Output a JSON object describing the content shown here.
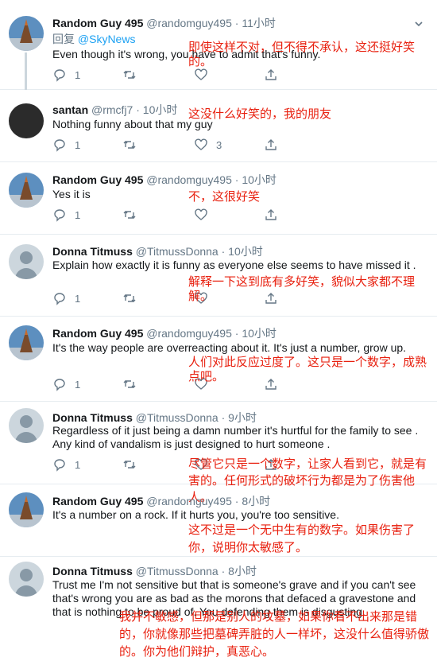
{
  "tweets": [
    {
      "name": "Random Guy 495",
      "handle": "@randomguy495",
      "time": "11小时",
      "reply_prefix": "回复",
      "reply_to": "@SkyNews",
      "text": "Even though it's wrong, you have to admit that's funny.",
      "replies": "1",
      "retweets": "",
      "likes": "",
      "translation": "即使这样不对，但不得不承认，这还挺好笑的。"
    },
    {
      "name": "santan",
      "handle": "@rmcfj7",
      "time": "10小时",
      "text": "Nothing funny about that my guy",
      "replies": "1",
      "retweets": "",
      "likes": "3",
      "translation": "这没什么好笑的，我的朋友"
    },
    {
      "name": "Random Guy 495",
      "handle": "@randomguy495",
      "time": "10小时",
      "text": "Yes it is",
      "replies": "1",
      "retweets": "",
      "likes": "",
      "translation": "不，这很好笑"
    },
    {
      "name": "Donna Titmuss",
      "handle": "@TitmussDonna",
      "time": "10小时",
      "text": "Explain how exactly it is funny as everyone else seems to have missed it .",
      "replies": "1",
      "retweets": "",
      "likes": "",
      "translation": "解释一下这到底有多好笑，貌似大家都不理解。"
    },
    {
      "name": "Random Guy 495",
      "handle": "@randomguy495",
      "time": "10小时",
      "text": "It's the way people are overreacting about it. It's just a number, grow up.",
      "replies": "1",
      "retweets": "",
      "likes": "",
      "translation": "人们对此反应过度了。这只是一个数字，成熟点吧。"
    },
    {
      "name": "Donna Titmuss",
      "handle": "@TitmussDonna",
      "time": "9小时",
      "text": "Regardless of it just being a damn number it's hurtful for the family to see . Any kind of vandalism is just designed to hurt someone .",
      "replies": "1",
      "retweets": "",
      "likes": "",
      "translation": "尽管它只是一个数字，让家人看到它，就是有害的。任何形式的破坏行为都是为了伤害他人。"
    },
    {
      "name": "Random Guy 495",
      "handle": "@randomguy495",
      "time": "8小时",
      "text": "It's a number on a rock. If it hurts you, you're too sensitive.",
      "replies": "1",
      "retweets": "",
      "likes": "",
      "translation": "这不过是一个无中生有的数字。如果伤害了你，说明你太敏感了。"
    },
    {
      "name": "Donna Titmuss",
      "handle": "@TitmussDonna",
      "time": "8小时",
      "text": "Trust me I'm not sensitive but that is someone's grave and if you can't see that's wrong you are as bad as the morons that defaced a gravestone and that is nothing to be proud of. You defending them is disgusting.",
      "replies": "",
      "retweets": "",
      "likes": "",
      "translation": "我并不敏感，但那是别人的坟墓，如果你看不出来那是错的，你就像那些把墓碑弄脏的人一样坏，这没什么值得骄傲的。你为他们辩护，真恶心。"
    }
  ],
  "colors": {
    "accent": "#1da1f2",
    "text": "#14171a",
    "muted": "#657786",
    "translation": "#e8200f"
  }
}
